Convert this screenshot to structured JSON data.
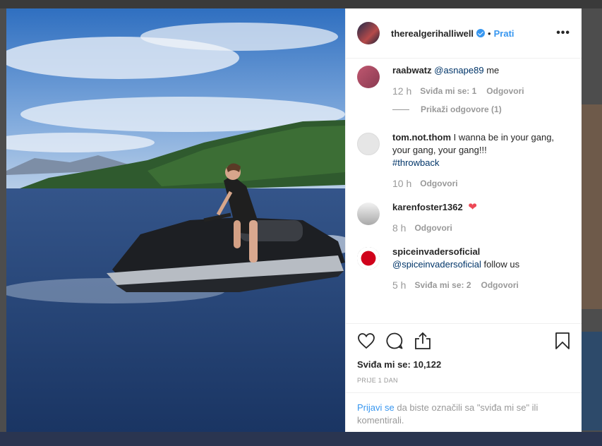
{
  "post": {
    "author": "therealgerihalliwell",
    "follow_label": "Prati",
    "more_label": "•••",
    "separator": "•"
  },
  "comments": [
    {
      "user": "raabwatz",
      "mention": "@asnape89",
      "text": " me",
      "time": "12 h",
      "likes": "Sviđa mi se: 1",
      "reply": "Odgovori",
      "view_replies": "Prikaži odgovore (1)"
    },
    {
      "user": "tom.not.thom",
      "text": " I wanna be in your gang, your gang, your gang!!!",
      "hashtag": "#throwback",
      "time": "10 h",
      "reply": "Odgovori"
    },
    {
      "user": "karenfoster1362",
      "emoji": "❤",
      "time": "8 h",
      "reply": "Odgovori"
    },
    {
      "user": "spiceinvadersoficial",
      "mention": "@spiceinvadersoficial",
      "text": " follow us",
      "time": "5 h",
      "likes": "Sviđa mi se: 2",
      "reply": "Odgovori"
    }
  ],
  "actions": {
    "likes_label": "Sviđa mi se: 10,122",
    "date": "PRIJE 1 DAN"
  },
  "login": {
    "link": "Prijavi se",
    "text": " da biste označili sa \"sviđa mi se\" ili komentirali."
  },
  "colors": {
    "accent": "#3897f0",
    "heart": "#ed4956",
    "text": "#262626",
    "muted": "#999999"
  },
  "icons": [
    "heart-outline-icon",
    "comment-icon",
    "share-icon",
    "bookmark-icon",
    "verified-badge-icon",
    "more-options-icon"
  ]
}
